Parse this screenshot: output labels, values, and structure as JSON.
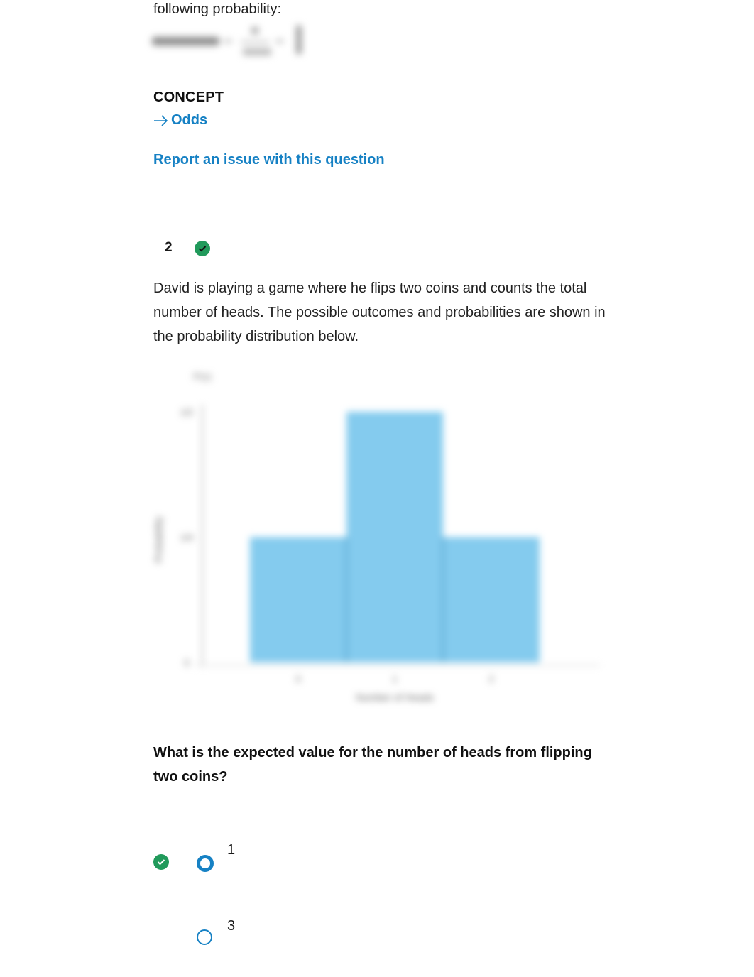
{
  "previous_question": {
    "trailing_text": "following probability:",
    "formula_blurred": "probability = 4/(4+4) = 1/2",
    "concept_heading": "CONCEPT",
    "concept_link": "Odds",
    "report_link": "Report an issue with this question"
  },
  "question": {
    "number": "2",
    "status": "correct",
    "prompt": "David is playing a game where he flips two coins and counts the total number of heads. The possible outcomes and probabilities are shown in the probability distribution below.",
    "ask": "What is the expected value for the number of heads from flipping two coins?",
    "options": [
      {
        "label": "1",
        "selected": true,
        "correct": true
      },
      {
        "label": "3",
        "selected": false,
        "correct": false
      }
    ]
  },
  "colors": {
    "accent": "#1681c4",
    "correct": "#219a5b",
    "bar": "#84cbee"
  },
  "chart_data": {
    "type": "bar",
    "title": "P(x)",
    "categories": [
      "0",
      "1",
      "2"
    ],
    "values": [
      0.25,
      0.5,
      0.25
    ],
    "xlabel": "Number of Heads",
    "ylabel": "Probability",
    "yticks": [
      "0",
      "1/4",
      "1/2"
    ],
    "ylim": [
      0,
      0.5
    ],
    "grid": false,
    "note": "chart rendered blurred in source"
  }
}
